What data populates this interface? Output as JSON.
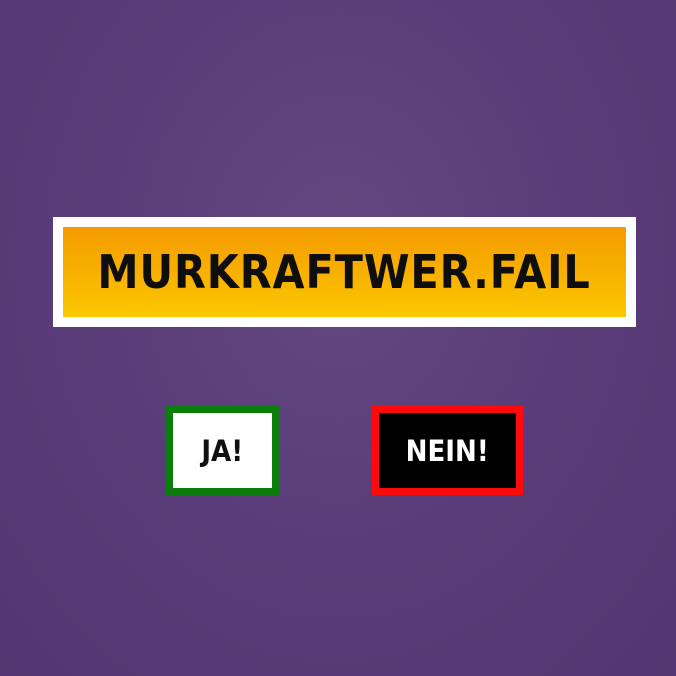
{
  "title": {
    "text": "MURKRAFTWER.FAIL"
  },
  "buttons": {
    "yes_label": "JA!",
    "no_label": "NEIN!"
  },
  "colors": {
    "background": "#5a3d7a",
    "title_gradient_top": "#f59b00",
    "title_gradient_bottom": "#fcc800",
    "yes_border": "#0a7d0a",
    "no_border": "#ff0a0a"
  }
}
